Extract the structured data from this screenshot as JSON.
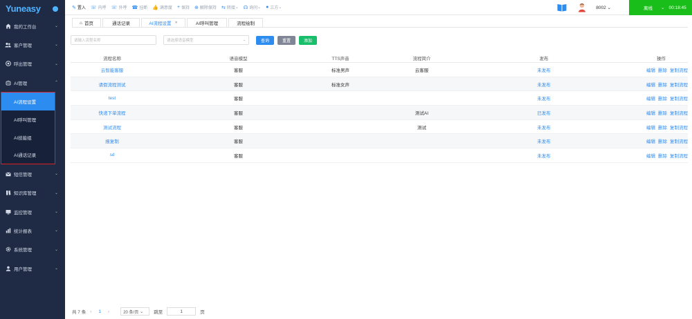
{
  "app": {
    "logo": "Yuneasy"
  },
  "sidebar": {
    "items": [
      {
        "label": "我的工作台",
        "icon": "home-icon"
      },
      {
        "label": "客户管理",
        "icon": "users-icon"
      },
      {
        "label": "呼出管理",
        "icon": "phone-out-icon"
      },
      {
        "label": "AI管理",
        "icon": "ai-icon",
        "expanded": true
      }
    ],
    "submenu": [
      {
        "label": "AI流程设置",
        "active": true
      },
      {
        "label": "AI呼叫管理"
      },
      {
        "label": "AI技能组"
      },
      {
        "label": "AI通话记录"
      }
    ],
    "items_after": [
      {
        "label": "短信管理",
        "icon": "mail-icon"
      },
      {
        "label": "知识库管理",
        "icon": "book-icon"
      },
      {
        "label": "监控管理",
        "icon": "monitor-icon"
      },
      {
        "label": "统计报表",
        "icon": "chart-icon"
      },
      {
        "label": "系统管理",
        "icon": "gear-icon"
      },
      {
        "label": "用户管理",
        "icon": "user-icon"
      }
    ]
  },
  "toolbar": {
    "tools": [
      "置入",
      "内呼",
      "外呼",
      "挂断",
      "满意度",
      "保持",
      "解除保持",
      "转接",
      "询问",
      "三方"
    ],
    "extension": "8002",
    "status": "离线",
    "timer": "00:18:45"
  },
  "tabs": [
    {
      "label": "首页"
    },
    {
      "label": "通话记录"
    },
    {
      "label": "AI流程设置",
      "active": true
    },
    {
      "label": "AI呼叫管理"
    },
    {
      "label": "流程绘制"
    }
  ],
  "filters": {
    "name_placeholder": "请输入流程名称",
    "model_placeholder": "请选择语音模型",
    "query": "查询",
    "reset": "重置",
    "add": "添加"
  },
  "table": {
    "columns": [
      "流程名称",
      "语音模型",
      "TTS声音",
      "流程简介",
      "发布",
      "操作"
    ],
    "actions": [
      "编辑",
      "删除",
      "复制流程"
    ],
    "rows": [
      {
        "name": "云智能客服",
        "model": "客服",
        "tts": "标准男声",
        "intro": "云客服",
        "publish": "未发布"
      },
      {
        "name": "请假流程测试",
        "model": "客服",
        "tts": "标准女声",
        "intro": "",
        "publish": "未发布"
      },
      {
        "name": "test",
        "model": "客服",
        "tts": "",
        "intro": "",
        "publish": "未发布"
      },
      {
        "name": "快递下单流程",
        "model": "客服",
        "tts": "",
        "intro": "测试AI",
        "publish": "已发布"
      },
      {
        "name": "测试流程",
        "model": "客服",
        "tts": "",
        "intro": "测试",
        "publish": "未发布"
      },
      {
        "name": "报复制",
        "model": "客服",
        "tts": "",
        "intro": "",
        "publish": "未发布"
      },
      {
        "name": "sd",
        "model": "客服",
        "tts": "",
        "intro": "",
        "publish": "未发布"
      }
    ]
  },
  "pager": {
    "total": "共 7 条",
    "page": "1",
    "page_size": "20 条/页",
    "jump_label": "跳至",
    "jump_value": "1",
    "page_unit": "页"
  },
  "colors": {
    "sidebar_bg": "#1f2a44",
    "accent": "#2d8cf0",
    "status_green": "#19be1a"
  }
}
